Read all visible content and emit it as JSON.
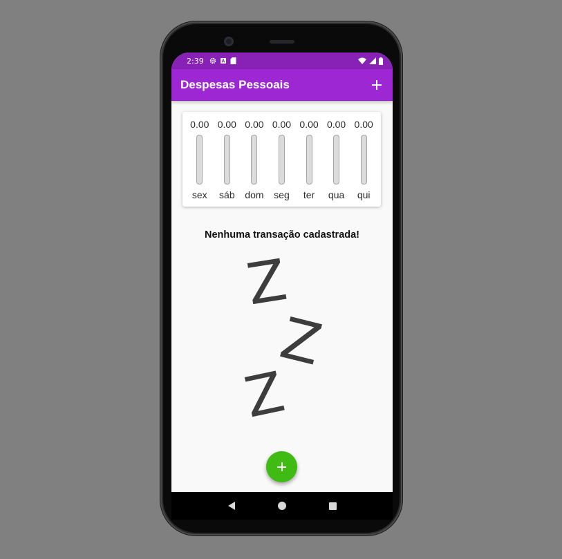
{
  "status_bar": {
    "time": "2:39",
    "left_icons": [
      "gear-icon",
      "a-box-icon",
      "sd-card-icon"
    ],
    "right_icons": [
      "wifi-icon",
      "signal-icon",
      "battery-icon"
    ]
  },
  "app_bar": {
    "title": "Despesas Pessoais",
    "action_icon": "add-icon"
  },
  "chart_data": {
    "type": "bar",
    "categories": [
      "sex",
      "sáb",
      "dom",
      "seg",
      "ter",
      "qua",
      "qui"
    ],
    "value_labels": [
      "0.00",
      "0.00",
      "0.00",
      "0.00",
      "0.00",
      "0.00",
      "0.00"
    ],
    "values": [
      0,
      0,
      0,
      0,
      0,
      0,
      0
    ],
    "fill_fraction": [
      0,
      0,
      0,
      0,
      0,
      0,
      0
    ]
  },
  "empty_state": {
    "message": "Nenhuma transação cadastrada!",
    "image_icon": "sleeping-zzz-icon"
  },
  "fab": {
    "icon": "add-icon"
  },
  "nav_bar": {
    "buttons": [
      "back-icon",
      "home-icon",
      "recents-icon"
    ]
  },
  "colors": {
    "status_bar": "#8821b6",
    "app_bar": "#9c27d3",
    "fab": "#3fbb14",
    "background": "#f8f9f8"
  }
}
